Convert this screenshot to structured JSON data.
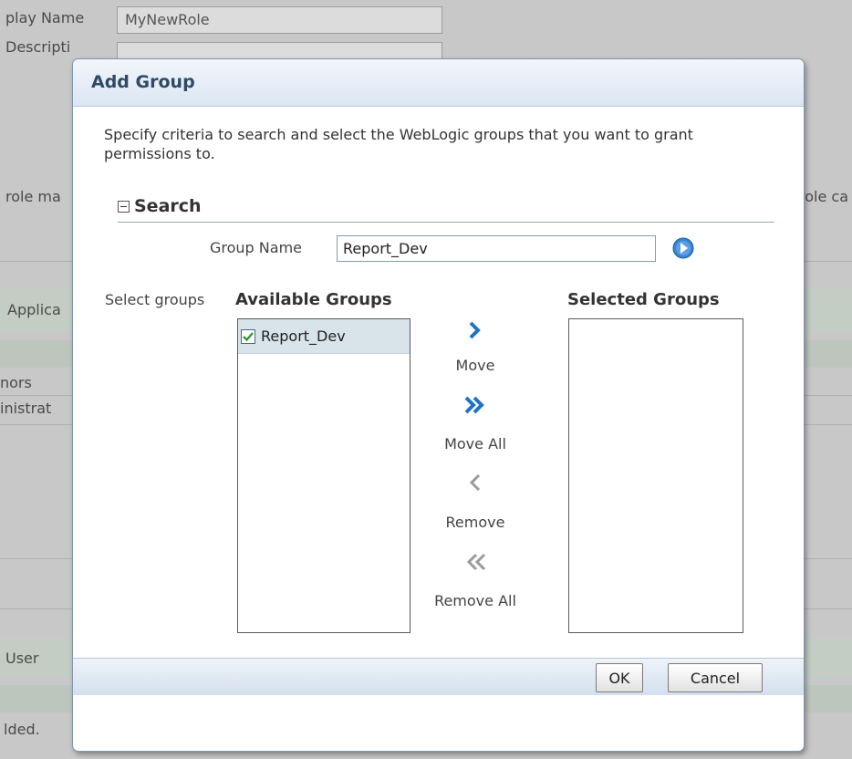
{
  "background": {
    "display_name_label": "play Name",
    "display_name_value": "MyNewRole",
    "description_label": "Descripti",
    "role_left_label": "role ma",
    "role_right_label": "role ca",
    "application_label": "Applica",
    "row_1": "nors",
    "row_2": "inistrat",
    "user_label": "User",
    "footer_text": "lded."
  },
  "dialog": {
    "title": "Add Group",
    "description": "Specify criteria to search and select the WebLogic groups that you want to grant permissions to.",
    "search_header": "Search",
    "group_name_label": "Group Name",
    "group_name_value": "Report_Dev",
    "select_groups_label": "Select groups",
    "available_title": "Available Groups",
    "selected_title": "Selected Groups",
    "available_items": [
      {
        "label": "Report_Dev",
        "checked": true
      }
    ],
    "selected_items": [],
    "move_label": "Move",
    "move_all_label": "Move All",
    "remove_label": "Remove",
    "remove_all_label": "Remove All",
    "ok_label": "OK",
    "cancel_label": "Cancel"
  },
  "icons": {
    "collapse": "collapse-minus-icon",
    "search_go": "go-arrow-icon",
    "checkbox": "checkmark-icon",
    "move": "chevron-right-icon",
    "move_all": "double-chevron-right-icon",
    "remove": "chevron-left-icon",
    "remove_all": "double-chevron-left-icon"
  },
  "colors": {
    "title_text": "#2f4a66",
    "shuttle_active": "#1e73c9",
    "shuttle_inactive": "#9a9a9a",
    "check_green": "#2f9a2f",
    "selected_row": "#d9e4ea"
  }
}
